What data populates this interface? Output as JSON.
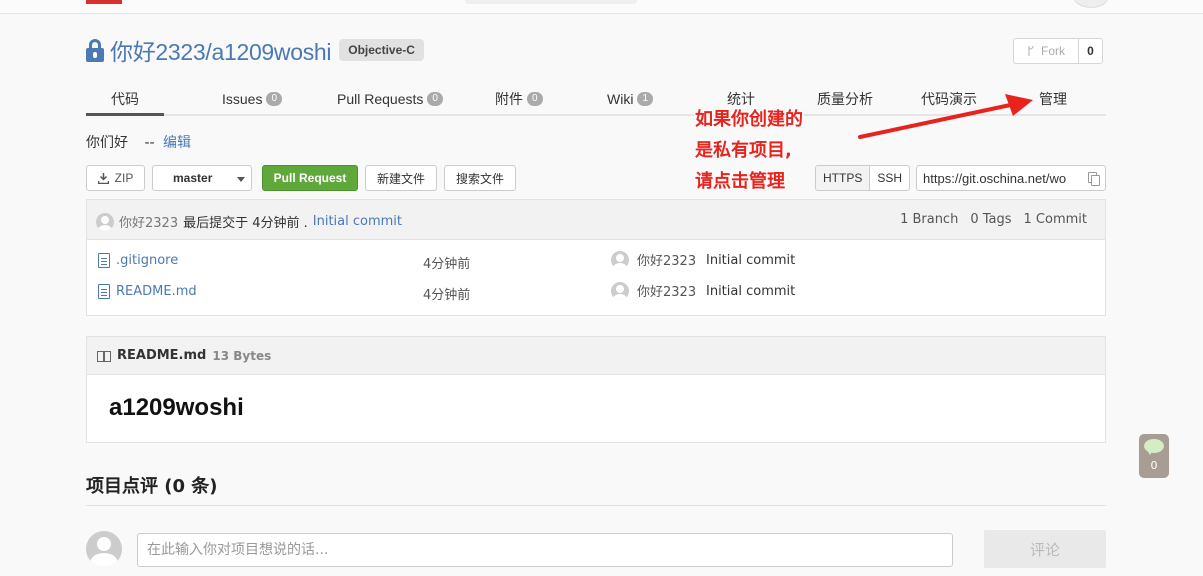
{
  "repo": {
    "owner": "你好2323",
    "separator": "/",
    "name": "a1209woshi",
    "language": "Objective-C",
    "fork_label": "Fork",
    "fork_count": "0"
  },
  "tabs": [
    {
      "label": "代码",
      "count": null
    },
    {
      "label": "Issues",
      "count": "0"
    },
    {
      "label": "Pull Requests",
      "count": "0"
    },
    {
      "label": "附件",
      "count": "0"
    },
    {
      "label": "Wiki",
      "count": "1"
    },
    {
      "label": "统计",
      "count": null
    },
    {
      "label": "质量分析",
      "count": null
    },
    {
      "label": "代码演示",
      "count": null
    },
    {
      "label": "管理",
      "count": null
    }
  ],
  "description": {
    "text": "你们好",
    "sep": "--",
    "edit_label": "编辑"
  },
  "toolbar": {
    "zip_label": "ZIP",
    "branch": "master",
    "pull_request_label": "Pull Request",
    "new_file_label": "新建文件",
    "search_file_label": "搜索文件",
    "https_label": "HTTPS",
    "ssh_label": "SSH",
    "clone_url": "https://git.oschina.net/wo"
  },
  "last_commit": {
    "user": "你好2323",
    "text": "最后提交于 4分钟前 .",
    "message": "Initial commit",
    "branches": "1 Branch",
    "tags": "0 Tags",
    "commits": "1 Commit"
  },
  "files": [
    {
      "name": ".gitignore",
      "time": "4分钟前",
      "author": "你好2323",
      "commit": "Initial commit"
    },
    {
      "name": "README.md",
      "time": "4分钟前",
      "author": "你好2323",
      "commit": "Initial commit"
    }
  ],
  "readme": {
    "name": "README.md",
    "size": "13 Bytes",
    "heading": "a1209woshi"
  },
  "comments": {
    "title": "项目点评 (0 条)",
    "placeholder": "在此输入你对项目想说的话...",
    "submit_label": "评论"
  },
  "float_button": {
    "count": "0"
  },
  "annotation": {
    "lines": [
      "如果你创建的",
      "是私有项目,",
      "请点击管理"
    ],
    "color": "#e8231d"
  },
  "colors": {
    "link": "#4a79b3",
    "pr_button": "#5fa83a",
    "brand": "#d9302b"
  }
}
